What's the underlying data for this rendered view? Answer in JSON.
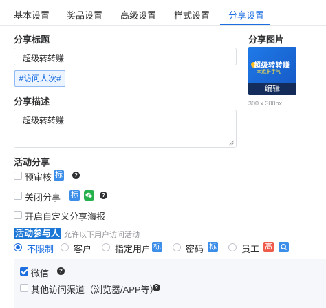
{
  "tabs": [
    {
      "label": "基本设置",
      "active": false
    },
    {
      "label": "奖品设置",
      "active": false
    },
    {
      "label": "高级设置",
      "active": false
    },
    {
      "label": "样式设置",
      "active": false
    },
    {
      "label": "分享设置",
      "active": true
    }
  ],
  "share_title": {
    "label": "分享标题",
    "value": "超级转转赚",
    "variable_tag": "#访问人次#"
  },
  "share_image": {
    "label": "分享图片",
    "promo_title": "超级转转赚",
    "promo_subtitle": "幸运拼手气",
    "edit_label": "编辑",
    "size_hint": "300 x 300px"
  },
  "share_desc": {
    "label": "分享描述",
    "value": "超级转转赚"
  },
  "activity_share": {
    "label": "活动分享",
    "options": [
      {
        "label": "预审核",
        "checked": false,
        "badge": "标"
      },
      {
        "label": "关闭分享",
        "checked": false,
        "badge": "标"
      },
      {
        "label": "开启自定义分享海报",
        "checked": false
      }
    ],
    "help_glyph": "?"
  },
  "participants": {
    "label": "活动参与人",
    "hint": "允许以下用户访问活动",
    "radios": [
      {
        "label": "不限制",
        "checked": true
      },
      {
        "label": "客户",
        "checked": false
      },
      {
        "label": "指定用户",
        "checked": false,
        "badge": "标"
      },
      {
        "label": "密码",
        "checked": false,
        "badge": "标"
      },
      {
        "label": "员工",
        "checked": false,
        "badge": "高"
      }
    ]
  },
  "channels": [
    {
      "label": "微信",
      "checked": true
    },
    {
      "label": "其他访问渠道（浏览器/APP等）",
      "checked": false
    }
  ],
  "colors": {
    "accent": "#1d6fe0",
    "badge_blue": "#3d8ee8",
    "badge_red": "#ef5a4a",
    "wechat_green": "#26b14d"
  }
}
